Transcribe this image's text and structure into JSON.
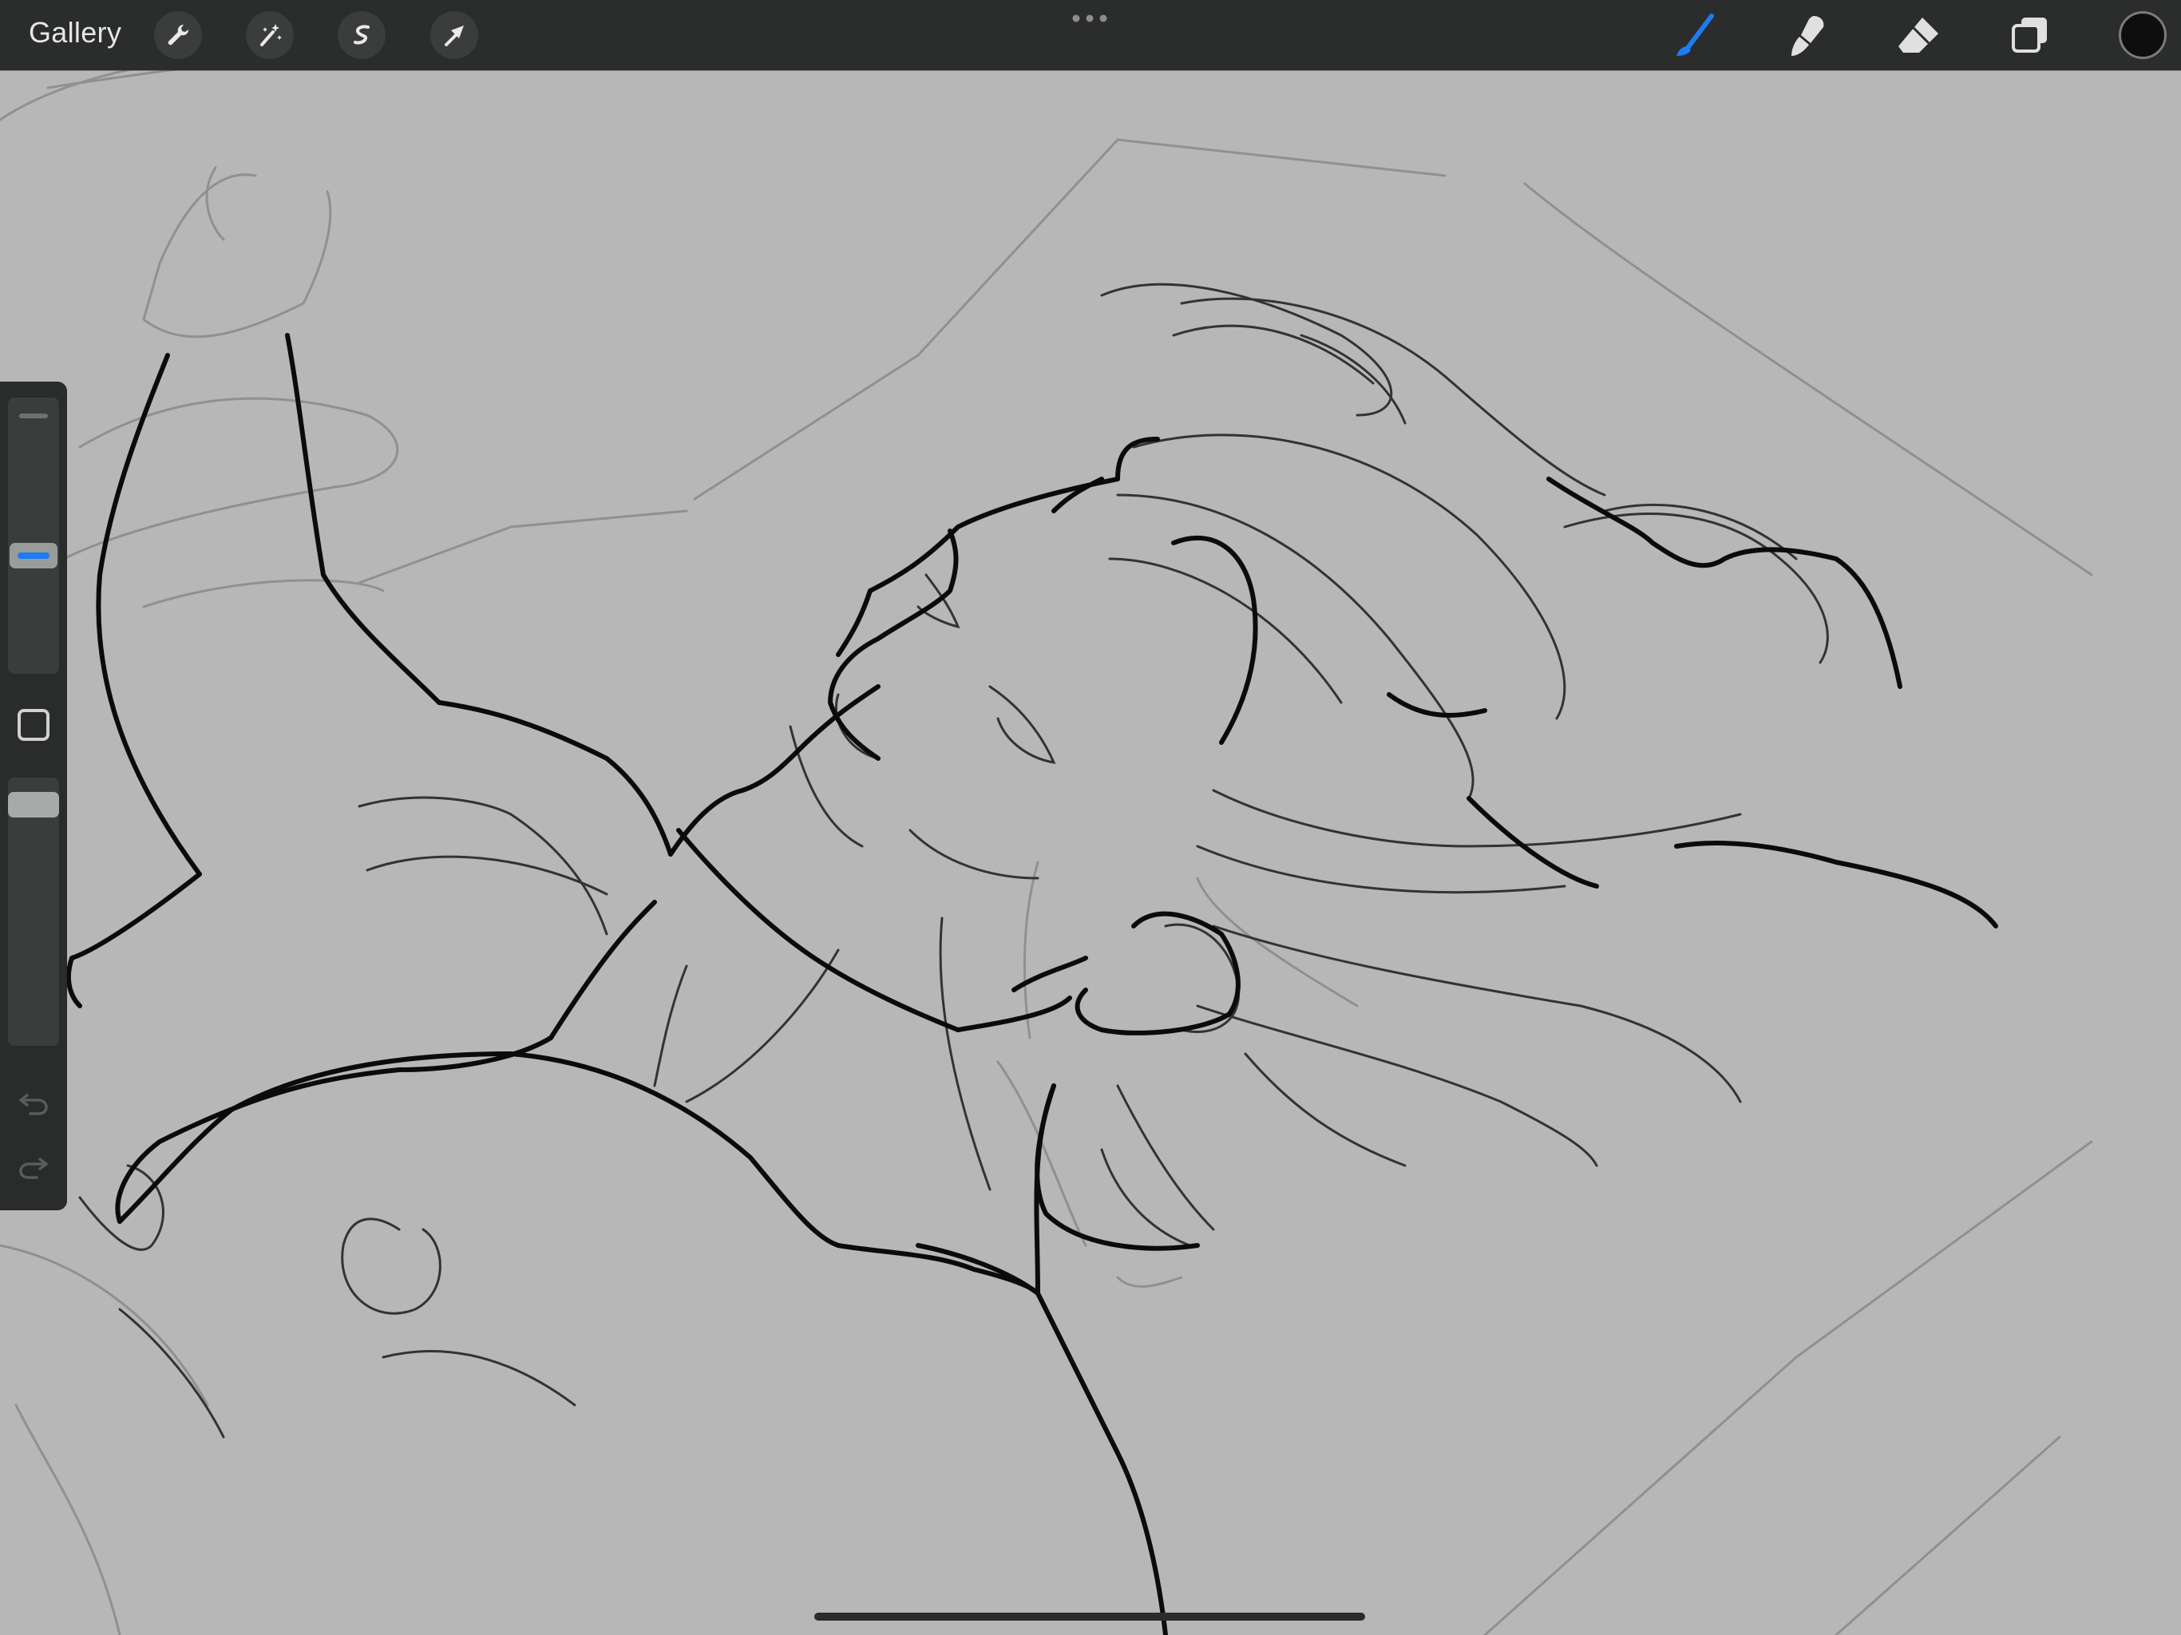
{
  "app": {
    "gallery_label": "Gallery",
    "accent_color": "#1d7cf2",
    "current_color": "#0e0e0e",
    "toolbar_color": "#2b2c2c",
    "canvas_color": "#b6b7b6"
  },
  "left_tools": [
    "wrench-icon",
    "magic-wand-icon",
    "selection-icon",
    "move-arrow-icon"
  ],
  "right_tools": [
    "brush-icon",
    "smudge-icon",
    "eraser-icon",
    "layers-icon",
    "color-swatch"
  ],
  "sidebar": {
    "controls": [
      "brush-size-slider",
      "modify-button",
      "opacity-slider",
      "undo-icon",
      "redo-icon"
    ]
  }
}
